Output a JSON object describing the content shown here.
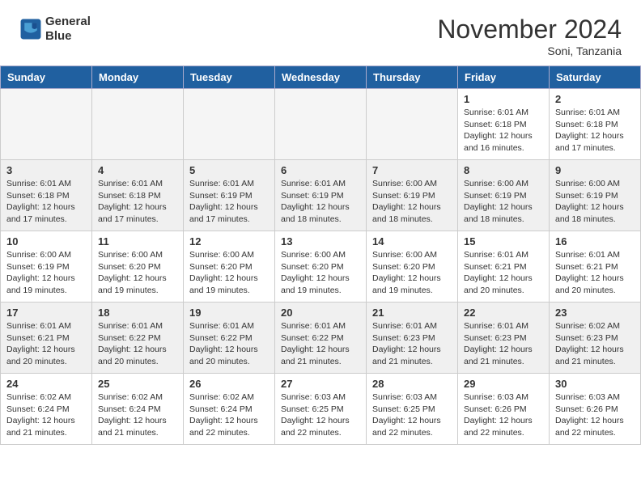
{
  "header": {
    "logo_line1": "General",
    "logo_line2": "Blue",
    "month_year": "November 2024",
    "location": "Soni, Tanzania"
  },
  "weekdays": [
    "Sunday",
    "Monday",
    "Tuesday",
    "Wednesday",
    "Thursday",
    "Friday",
    "Saturday"
  ],
  "weeks": [
    [
      {
        "day": "",
        "info": ""
      },
      {
        "day": "",
        "info": ""
      },
      {
        "day": "",
        "info": ""
      },
      {
        "day": "",
        "info": ""
      },
      {
        "day": "",
        "info": ""
      },
      {
        "day": "1",
        "info": "Sunrise: 6:01 AM\nSunset: 6:18 PM\nDaylight: 12 hours\nand 16 minutes."
      },
      {
        "day": "2",
        "info": "Sunrise: 6:01 AM\nSunset: 6:18 PM\nDaylight: 12 hours\nand 17 minutes."
      }
    ],
    [
      {
        "day": "3",
        "info": "Sunrise: 6:01 AM\nSunset: 6:18 PM\nDaylight: 12 hours\nand 17 minutes."
      },
      {
        "day": "4",
        "info": "Sunrise: 6:01 AM\nSunset: 6:18 PM\nDaylight: 12 hours\nand 17 minutes."
      },
      {
        "day": "5",
        "info": "Sunrise: 6:01 AM\nSunset: 6:19 PM\nDaylight: 12 hours\nand 17 minutes."
      },
      {
        "day": "6",
        "info": "Sunrise: 6:01 AM\nSunset: 6:19 PM\nDaylight: 12 hours\nand 18 minutes."
      },
      {
        "day": "7",
        "info": "Sunrise: 6:00 AM\nSunset: 6:19 PM\nDaylight: 12 hours\nand 18 minutes."
      },
      {
        "day": "8",
        "info": "Sunrise: 6:00 AM\nSunset: 6:19 PM\nDaylight: 12 hours\nand 18 minutes."
      },
      {
        "day": "9",
        "info": "Sunrise: 6:00 AM\nSunset: 6:19 PM\nDaylight: 12 hours\nand 18 minutes."
      }
    ],
    [
      {
        "day": "10",
        "info": "Sunrise: 6:00 AM\nSunset: 6:19 PM\nDaylight: 12 hours\nand 19 minutes."
      },
      {
        "day": "11",
        "info": "Sunrise: 6:00 AM\nSunset: 6:20 PM\nDaylight: 12 hours\nand 19 minutes."
      },
      {
        "day": "12",
        "info": "Sunrise: 6:00 AM\nSunset: 6:20 PM\nDaylight: 12 hours\nand 19 minutes."
      },
      {
        "day": "13",
        "info": "Sunrise: 6:00 AM\nSunset: 6:20 PM\nDaylight: 12 hours\nand 19 minutes."
      },
      {
        "day": "14",
        "info": "Sunrise: 6:00 AM\nSunset: 6:20 PM\nDaylight: 12 hours\nand 19 minutes."
      },
      {
        "day": "15",
        "info": "Sunrise: 6:01 AM\nSunset: 6:21 PM\nDaylight: 12 hours\nand 20 minutes."
      },
      {
        "day": "16",
        "info": "Sunrise: 6:01 AM\nSunset: 6:21 PM\nDaylight: 12 hours\nand 20 minutes."
      }
    ],
    [
      {
        "day": "17",
        "info": "Sunrise: 6:01 AM\nSunset: 6:21 PM\nDaylight: 12 hours\nand 20 minutes."
      },
      {
        "day": "18",
        "info": "Sunrise: 6:01 AM\nSunset: 6:22 PM\nDaylight: 12 hours\nand 20 minutes."
      },
      {
        "day": "19",
        "info": "Sunrise: 6:01 AM\nSunset: 6:22 PM\nDaylight: 12 hours\nand 20 minutes."
      },
      {
        "day": "20",
        "info": "Sunrise: 6:01 AM\nSunset: 6:22 PM\nDaylight: 12 hours\nand 21 minutes."
      },
      {
        "day": "21",
        "info": "Sunrise: 6:01 AM\nSunset: 6:23 PM\nDaylight: 12 hours\nand 21 minutes."
      },
      {
        "day": "22",
        "info": "Sunrise: 6:01 AM\nSunset: 6:23 PM\nDaylight: 12 hours\nand 21 minutes."
      },
      {
        "day": "23",
        "info": "Sunrise: 6:02 AM\nSunset: 6:23 PM\nDaylight: 12 hours\nand 21 minutes."
      }
    ],
    [
      {
        "day": "24",
        "info": "Sunrise: 6:02 AM\nSunset: 6:24 PM\nDaylight: 12 hours\nand 21 minutes."
      },
      {
        "day": "25",
        "info": "Sunrise: 6:02 AM\nSunset: 6:24 PM\nDaylight: 12 hours\nand 21 minutes."
      },
      {
        "day": "26",
        "info": "Sunrise: 6:02 AM\nSunset: 6:24 PM\nDaylight: 12 hours\nand 22 minutes."
      },
      {
        "day": "27",
        "info": "Sunrise: 6:03 AM\nSunset: 6:25 PM\nDaylight: 12 hours\nand 22 minutes."
      },
      {
        "day": "28",
        "info": "Sunrise: 6:03 AM\nSunset: 6:25 PM\nDaylight: 12 hours\nand 22 minutes."
      },
      {
        "day": "29",
        "info": "Sunrise: 6:03 AM\nSunset: 6:26 PM\nDaylight: 12 hours\nand 22 minutes."
      },
      {
        "day": "30",
        "info": "Sunrise: 6:03 AM\nSunset: 6:26 PM\nDaylight: 12 hours\nand 22 minutes."
      }
    ]
  ]
}
